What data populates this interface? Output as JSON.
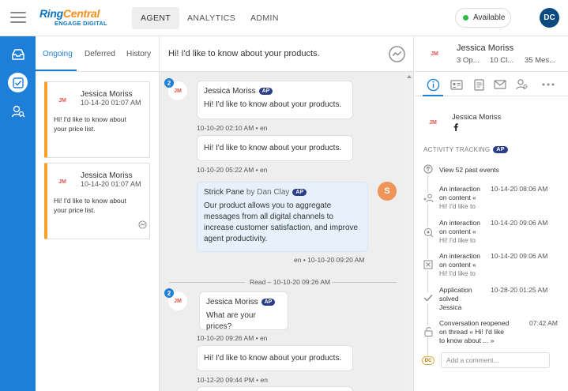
{
  "brand": {
    "name_part1": "Ring",
    "name_part2": "Central",
    "product": "ENGAGE DIGITAL"
  },
  "nav": {
    "tabs": [
      {
        "label": "AGENT"
      },
      {
        "label": "ANALYTICS"
      },
      {
        "label": "ADMIN"
      }
    ]
  },
  "status": {
    "label": "Available",
    "color": "#2dbb4a"
  },
  "user": {
    "initials": "DC"
  },
  "list": {
    "tabs": [
      {
        "label": "Ongoing"
      },
      {
        "label": "Deferred"
      },
      {
        "label": "History"
      }
    ],
    "cards": [
      {
        "initials": "JM",
        "name": "Jessica Moriss",
        "date": "10-14-20 01:07 AM",
        "text": "Hi! I'd like to know about your price list."
      },
      {
        "initials": "JM",
        "name": "Jessica Moriss",
        "date": "10-14-20 01:07 AM",
        "text": "Hi! I'd like to know about your price list."
      }
    ]
  },
  "thread": {
    "title": "Hi! I'd like to know about your products.",
    "messages": [
      {
        "name": "Jessica Moriss",
        "badge": "AP",
        "text": "Hi! I'd like to know about your products.",
        "meta": "10-10-20 02:10 AM • en"
      },
      {
        "text": "Hi! I'd like to know about your products.",
        "meta": "10-10-20 05:22 AM • en"
      },
      {
        "name": "Strick Pane",
        "by": "by Dan Clay",
        "badge": "AP",
        "text": "Our product allows you to aggregate messages from all digital channels to increase customer satisfaction, and improve agent productivity.",
        "meta": "en • 10-10-20 09:20 AM",
        "initial": "S"
      },
      {
        "name": "Jessica Moriss",
        "badge": "AP",
        "text": "What are your prices?",
        "meta": "10-10-20 09:26 AM • en"
      },
      {
        "text": "Hi! I'd like to know about your products.",
        "meta": "10-12-20 09:44 PM • en"
      }
    ],
    "read_marker": "Read – 10-10-20 09:26 AM",
    "avatar_initials": "JM",
    "count_badges": [
      "2",
      "2"
    ]
  },
  "details": {
    "name": "Jessica Moriss",
    "initials": "JM",
    "stats": [
      {
        "label": "3 Op..."
      },
      {
        "label": "10 Cl..."
      },
      {
        "label": "35 Mes..."
      }
    ],
    "profile_name": "Jessica Moriss",
    "activity_label": "ACTIVITY TRACKING",
    "activity_badge": "AP",
    "view_past": "View 52 past events",
    "events": [
      {
        "line1": "An interaction",
        "line2": "on content «",
        "line3": "Hi! I'd like to",
        "date": "10-14-20 08:06 AM"
      },
      {
        "line1": "An interaction",
        "line2": "on content «",
        "line3": "Hi! I'd like to",
        "date": "10-14-20 09:06 AM"
      },
      {
        "line1": "An interaction",
        "line2": "on content «",
        "line3": "Hi! I'd like to",
        "date": "10-14-20 09:06 AM"
      },
      {
        "line1": "Application",
        "line2": "solved",
        "line3": "Jessica",
        "date": "10-28-20 01:25 AM"
      },
      {
        "line1": "Conversation reopened",
        "line2": "on thread « Hi! I'd like",
        "line3": "to know about ... »",
        "date": "07:42 AM"
      }
    ],
    "comment_badge": "DC",
    "comment_placeholder": "Add a comment..."
  },
  "colors": {
    "accent": "#1e7fd9",
    "rail": "#1e7fd9",
    "pending": "#f5a02a",
    "agent_bubble": "#e6f1fb"
  }
}
